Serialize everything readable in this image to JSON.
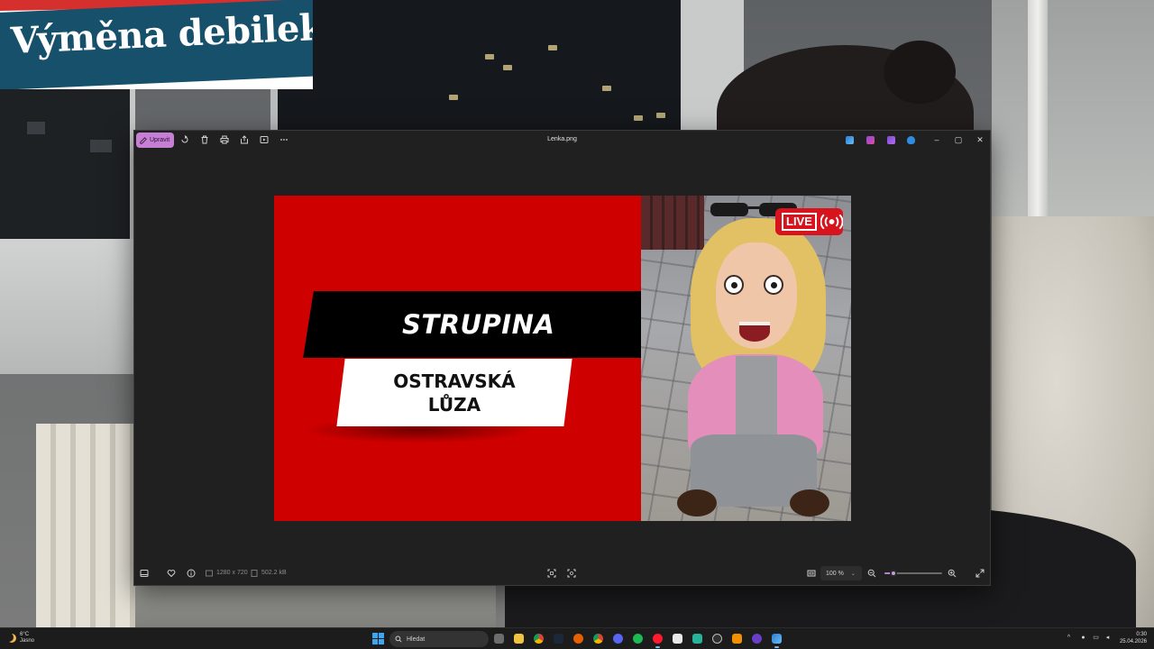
{
  "overlay": {
    "banner_title": "Výměna debilek"
  },
  "photos_window": {
    "edit_label": "Upravit",
    "file_title": "Lenka.png",
    "image": {
      "band_title": "STRUPINA",
      "subtitle_line1": "OSTRAVSKÁ",
      "subtitle_line2": "LŮZA",
      "live_badge": "LIVE"
    },
    "status": {
      "dimensions": "1280 x 720",
      "file_size": "502.2 kB",
      "zoom_value": "100 %",
      "zoom_slider_fraction": 0.15
    }
  },
  "taskbar": {
    "weather_temp": "6°C",
    "weather_condition": "Jasno",
    "search_placeholder": "Hledat",
    "time": "0:30",
    "date": "25.04.2026"
  },
  "colors": {
    "thumbnail_red": "#cf0000",
    "edit_button": "#c77fd6",
    "live_badge": "#d7141d",
    "banner_blue": "#16506a"
  },
  "icons": {
    "titlebar": [
      "edit-icon",
      "rotate-icon",
      "delete-icon",
      "print-icon",
      "share-icon",
      "slideshow-icon",
      "more-icon"
    ],
    "status": [
      "filmstrip-icon",
      "favorite-icon",
      "info-icon",
      "fit-icon",
      "actual-size-icon",
      "zoom-out-icon",
      "zoom-in-icon",
      "fullscreen-icon"
    ]
  }
}
